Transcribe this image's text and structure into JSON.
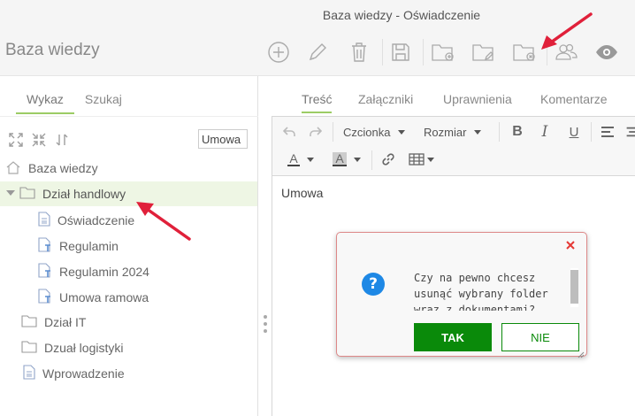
{
  "window": {
    "title": "Baza wiedzy - Oświadczenie"
  },
  "app": {
    "title": "Baza wiedzy"
  },
  "left_tabs": [
    {
      "label": "Wykaz",
      "active": true
    },
    {
      "label": "Szukaj",
      "active": false
    }
  ],
  "tree_tools": {
    "search_value": "Umowa",
    "icons": [
      "expand-all-icon",
      "collapse-all-icon",
      "refresh-icon"
    ]
  },
  "tree": {
    "root": {
      "label": "Baza wiedzy",
      "icon": "home-icon"
    },
    "items": [
      {
        "label": "Dział handlowy",
        "type": "folder",
        "expanded": true,
        "selected": true
      },
      {
        "label": "Oświadczenie",
        "type": "document"
      },
      {
        "label": "Regulamin",
        "type": "document-pinned"
      },
      {
        "label": "Regulamin 2024",
        "type": "document-pinned"
      },
      {
        "label": "Umowa ramowa",
        "type": "document-pinned"
      },
      {
        "label": "Dział IT",
        "type": "folder"
      },
      {
        "label": "Dzuał logistyki",
        "type": "folder"
      },
      {
        "label": "Wprowadzenie",
        "type": "document"
      }
    ]
  },
  "toolbar": {
    "icons": [
      "add-icon",
      "edit-icon",
      "delete-icon",
      "save-icon",
      "new-folder-icon",
      "edit-folder-icon",
      "delete-folder-icon",
      "permissions-icon",
      "preview-icon"
    ]
  },
  "right_tabs": [
    {
      "label": "Treść",
      "active": true
    },
    {
      "label": "Załączniki",
      "active": false
    },
    {
      "label": "Uprawnienia",
      "active": false
    },
    {
      "label": "Komentarze",
      "active": false
    }
  ],
  "editor": {
    "font_label": "Czcionka",
    "size_label": "Rozmiar",
    "content": "Umowa"
  },
  "dialog": {
    "message": "Czy na pewno chcesz usunąć wybrany folder wraz z dokumentami?",
    "confirm_label": "TAK",
    "cancel_label": "NIE"
  },
  "colors": {
    "accent_green": "#9ccc65",
    "confirm_green": "#0a8a0a",
    "arrow_red": "#e0203a",
    "question_blue": "#1e88e5",
    "close_red": "#e53935"
  }
}
